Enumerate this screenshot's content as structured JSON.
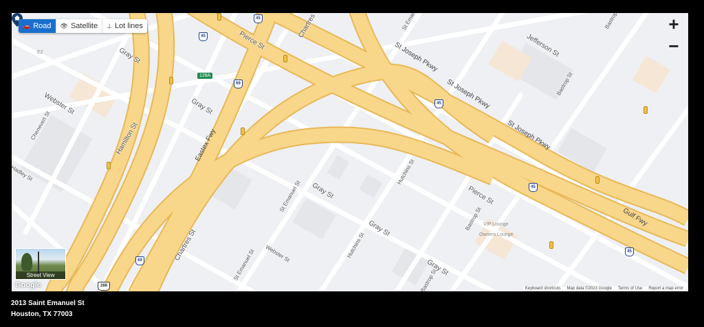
{
  "map_types": [
    {
      "label": "Road",
      "icon": "car-icon",
      "active": true
    },
    {
      "label": "Satellite",
      "icon": "eye-icon",
      "active": false
    },
    {
      "label": "Lot lines",
      "icon": "lot-lines-icon",
      "active": false
    }
  ],
  "zoom": {
    "in_label": "+",
    "out_label": "−"
  },
  "street_view": {
    "label": "Street View"
  },
  "logo": "Google",
  "attribution": {
    "keyboard": "Keyboard shortcuts",
    "map_data": "Map data ©2023 Google",
    "terms": "Terms of Use",
    "report": "Report a map error"
  },
  "streets": {
    "gray_st_1": "Gray St",
    "gray_st_2": "Gray St",
    "gray_st_3": "Gray St",
    "gray_st_4": "Gray St",
    "gray_st_5": "Gray St",
    "pierce_st_1": "Pierce St",
    "pierce_st_2": "Pierce St",
    "webster_st_1": "Webster St",
    "webster_st_2": "Webster St",
    "chenevert_st": "Chenevert St",
    "hamilton_st": "Hamilton St",
    "hadley_st": "Hadley St",
    "eastex_fwy": "Eastex Fwy",
    "chartres_st_1": "Chartres St",
    "chartres_st_2": "Chartres St",
    "st_emanuel_st_1": "St Emanuel St",
    "st_emanuel_st_2": "St Emanuel St",
    "st_emanuel_st_3": "St Emanuel St",
    "hutchins_st_1": "Hutchins St",
    "hutchins_st_2": "Hutchins St",
    "bastrop_st_1": "Bastrop St",
    "bastrop_st_2": "Bastrop St",
    "bastrop_st_3": "Bastrop St",
    "bastrop_st_4": "Bastrop St",
    "st_joseph_pkwy_1": "St Joseph Pkwy",
    "st_joseph_pkwy_2": "St Joseph Pkwy",
    "st_joseph_pkwy_3": "St Joseph Pkwy",
    "jefferson_st": "Jefferson St",
    "gulf_fwy": "Gulf Fwy"
  },
  "places": {
    "vip_lounge": "VIP Lounge",
    "owners_lounge": "Owners Lounge",
    "e2": "E2"
  },
  "shields": {
    "i45_a": "45",
    "i45_b": "45",
    "i45_c": "45",
    "i45_d": "45",
    "i45_e": "45",
    "i69_a": "69",
    "i69_b": "69",
    "us288": "288"
  },
  "exit_badge": "128A",
  "address": {
    "line1": "2013 Saint Emanuel St",
    "line2": "Houston, TX 77003"
  },
  "colors": {
    "highway": "#f8d68a",
    "highway_edge": "#e8b857",
    "background": "#eef0f3",
    "street": "#ffffff",
    "building": "#e3e5e9",
    "accent": "#1a6fce",
    "marker": "#1a3d6e"
  }
}
